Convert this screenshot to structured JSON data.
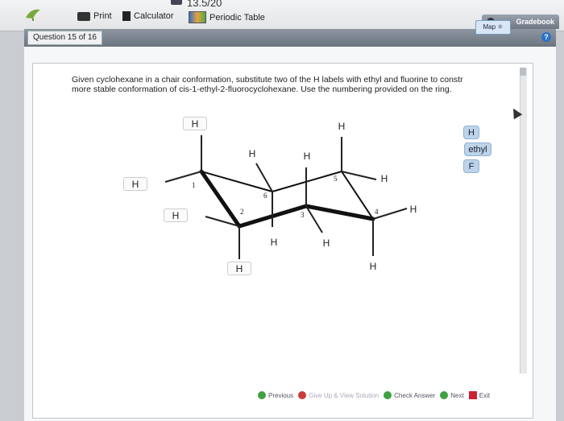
{
  "header": {
    "score": "13.5/20",
    "tools": [
      {
        "label": "Print",
        "icon": "printer-icon"
      },
      {
        "label": "Calculator",
        "icon": "calculator-icon"
      },
      {
        "label": "Periodic Table",
        "icon": "periodic-table-icon"
      }
    ],
    "gradebook": "Gradebook"
  },
  "question_bar": {
    "counter": "Question 15 of 16"
  },
  "question": {
    "text_line1": "Given cyclohexane in a chair conformation, substitute two of the H labels with ethyl and fluorine to constr",
    "text_line2": "more stable conformation of cis-1-ethyl-2-fluorocyclohexane. Use the numbering provided on the ring.",
    "map_button": "Map"
  },
  "molecule": {
    "h_labels": [
      "H",
      "H",
      "H",
      "H",
      "H",
      "H",
      "H",
      "H",
      "H",
      "H",
      "H",
      "H"
    ],
    "ring_numbers": [
      "1",
      "2",
      "3",
      "4",
      "5",
      "6"
    ]
  },
  "palette": [
    "H",
    "ethyl",
    "F"
  ],
  "footer": {
    "previous": "Previous",
    "give_up": "Give Up & View Solution",
    "check": "Check Answer",
    "next": "Next",
    "exit": "Exit"
  }
}
